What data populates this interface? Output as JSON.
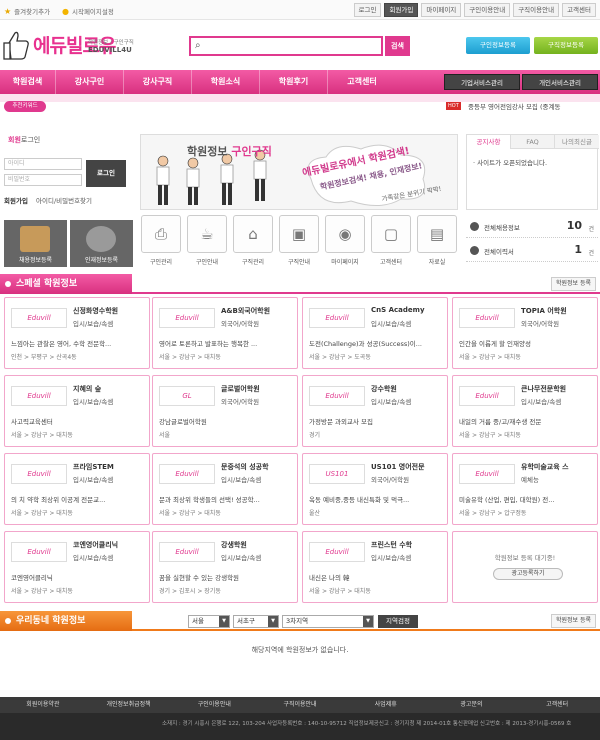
{
  "top": {
    "bookmark": "즐겨찾기추가",
    "homepage": "시작페이지설정",
    "links": [
      "로그인",
      "회원가입",
      "마이페이지",
      "구인이용안내",
      "구직이용안내",
      "고객센터"
    ]
  },
  "header": {
    "logo_text": "에듀빌로유",
    "logo_sub": "학원정보 / 구인구직",
    "logo_en": "EDUVILL4U",
    "search_placeholder": "",
    "search_button": "검색",
    "btn_job_post": "구인정보등록",
    "btn_seek_post": "구직정보등록"
  },
  "nav": {
    "items": [
      "학원검색",
      "강사구인",
      "강사구직",
      "학원소식",
      "학원후기",
      "고객센터"
    ],
    "biz1": "기업서비스관리",
    "biz2": "개인서비스관리"
  },
  "ticker": {
    "keyword_label": "추천키워드",
    "hot": "HOT",
    "text": "중등부 영어전임강사 모집 (중계동"
  },
  "login": {
    "title_bold": "회원",
    "title_rest": "로그인",
    "id_placeholder": "아이디",
    "pw_placeholder": "비밀번호",
    "login_button": "로그인",
    "join": "회원가입",
    "find": "아이디/비밀번호찾기"
  },
  "banner": {
    "title": "학원정보",
    "title_accent": "구인구직",
    "headline1": "에듀빌로유에서 학원검색!",
    "headline2": "학원정보검색! 채용, 인재정보!",
    "headline3": "가족같은 분위기 팍팍!"
  },
  "tabs": {
    "items": [
      "공지사항",
      "FAQ",
      "나의최신글"
    ],
    "news": "· 사이트가 오픈되었습니다."
  },
  "quick": {
    "academy_reg": "채용정보등록",
    "talent_reg": "인재정보등록"
  },
  "icons": [
    {
      "label": "구인관리",
      "icon": "printer-icon",
      "glyph": "⎙"
    },
    {
      "label": "구인안내",
      "icon": "cup-icon",
      "glyph": "☕"
    },
    {
      "label": "구직관리",
      "icon": "house-icon",
      "glyph": "⌂"
    },
    {
      "label": "구직안내",
      "icon": "radio-icon",
      "glyph": "▣"
    },
    {
      "label": "마이페이지",
      "icon": "camera-icon",
      "glyph": "◉"
    },
    {
      "label": "고객센터",
      "icon": "tv-icon",
      "glyph": "▢"
    },
    {
      "label": "자료실",
      "icon": "disk-icon",
      "glyph": "▤"
    }
  ],
  "stats": {
    "jobs_label": "전체채용정보",
    "jobs_value": "10",
    "resumes_label": "전체이력서",
    "resumes_value": "1",
    "unit": "건"
  },
  "special": {
    "title": "스페셜 학원정보",
    "register": "학원정보 등록",
    "cards": [
      {
        "logo": "Eduvill",
        "name": "신정화영수학원",
        "cat": "입시/보습/속셈",
        "desc": "느낌아는 관찰은 영어, 수학 전문학...",
        "loc": "인천 > 부평구 > 산곡4동"
      },
      {
        "logo": "Eduvill",
        "name": "A&B외국어학원",
        "cat": "외국어/어학원",
        "desc": "영어로 토론하고 발표하는 행복한 ...",
        "loc": "서울 > 강남구 > 대치동"
      },
      {
        "logo": "Eduvill",
        "name": "CnS Academy",
        "cat": "입시/보습/속셈",
        "desc": "도전(Challenge)과 성공(Success)이...",
        "loc": "서울 > 강남구 > 도곡동"
      },
      {
        "logo": "Eduvill",
        "name": "TOPIA 어학원",
        "cat": "외국어/어학원",
        "desc": "인간을 이롭게 할 인재양성",
        "loc": "서울 > 강남구 > 대치동"
      },
      {
        "logo": "Eduvill",
        "name": "지혜의 숲",
        "cat": "입시/보습/속셈",
        "desc": "사고력교육센터",
        "loc": "서울 > 강남구 > 대치동"
      },
      {
        "logo": "GL",
        "name": "글로벌어학원",
        "cat": "외국어/어학원",
        "desc": "강남글로벌어학원",
        "loc": "서울"
      },
      {
        "logo": "Eduvill",
        "name": "강수학원",
        "cat": "입시/보습/속셈",
        "desc": "가정방문 과외교사 모집",
        "loc": "경기"
      },
      {
        "logo": "Eduvill",
        "name": "큰나무전문학원",
        "cat": "입시/보습/속셈",
        "desc": "내일의 거름 중/고/재수생 전문",
        "loc": "서울 > 강남구 > 대치동"
      },
      {
        "logo": "Eduvill",
        "name": "프라임STEM",
        "cat": "입시/보습/속셈",
        "desc": "의 치 약학 최상위 이공계 전문교...",
        "loc": "서울 > 강남구 > 대치동"
      },
      {
        "logo": "Eduvill",
        "name": "문중석의 성공학",
        "cat": "입시/보습/속셈",
        "desc": "문과 최상위 학생들의 선택! 성공학...",
        "loc": "서울 > 강남구 > 대치동"
      },
      {
        "logo": "US101",
        "name": "US101 영어전문",
        "cat": "외국어/어학원",
        "desc": "옥동 예비중,중등 내신특화 및 먹극...",
        "loc": "울산"
      },
      {
        "logo": "Eduvill",
        "name": "유학미술교육 스",
        "cat": "예체능",
        "desc": "미술유학 (산업, 편입, 대학원) 전...",
        "loc": "서울 > 강남구 > 압구정동"
      },
      {
        "logo": "Eduvill",
        "name": "코엔영어클리닉",
        "cat": "입시/보습/속셈",
        "desc": "코엔영어클리닉",
        "loc": "서울 > 강남구 > 대치동"
      },
      {
        "logo": "Eduvill",
        "name": "강생학원",
        "cat": "입시/보습/속셈",
        "desc": "꿈을 실현할 수 있는 강생학원",
        "loc": "경기 > 김포시 > 장기동"
      },
      {
        "logo": "Eduvill",
        "name": "프린스턴 수학",
        "cat": "입시/보습/속셈",
        "desc": "내신은 나의 韓",
        "loc": "서울 > 강남구 > 대치동"
      }
    ],
    "empty_msg": "학원정보 등록 대기중!",
    "empty_btn": "광고등록하기"
  },
  "local": {
    "title": "우리동네 학원정보",
    "register": "학원정보 등록",
    "sel1": "서울",
    "sel2": "서초구",
    "sel3": "3차지역",
    "search_btn": "지역검정",
    "no_info": "해당지역에 학원정보가 없습니다."
  },
  "footer": {
    "links": [
      "회원이용약관",
      "개인정보취급정책",
      "구인이용안내",
      "구직이용안내",
      "사업제휴",
      "광고문의",
      "고객센터"
    ],
    "address": "소재지 : 경기 시흥시 은행로 122, 103-204   사업자등록번호 : 140-10-95712   직업정보제공신고 : 경기지청 제 2014-01호   통신판매업 신고번호 : 제 2013-경기시흥-0569 호"
  },
  "colors": {
    "accent": "#e0398e",
    "special_bar": "#e0398e",
    "local_bar": "#f07a1a"
  }
}
